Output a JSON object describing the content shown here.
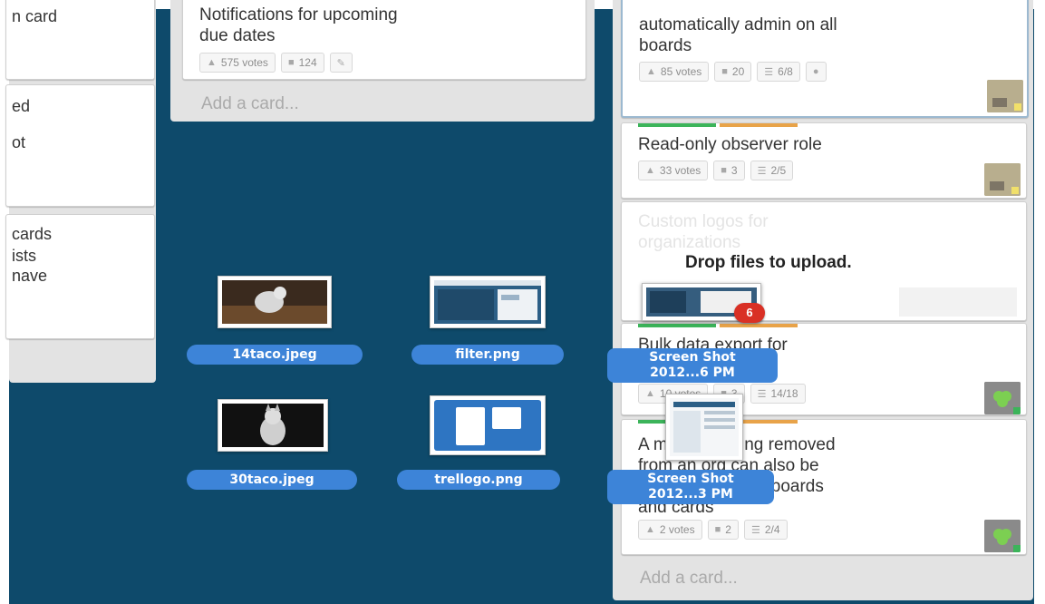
{
  "left_list": {
    "card1_text": "n card",
    "card2_lines": [
      "ed",
      "ot"
    ],
    "card3_lines": [
      "cards",
      "ists",
      "nave"
    ]
  },
  "middle_list": {
    "card": {
      "title_line1": "Notifications for upcoming",
      "title_line2": "due dates",
      "votes": "575 votes",
      "comments": "124"
    },
    "add_card": "Add a card..."
  },
  "right_list": {
    "card1": {
      "title_line1": "automatically admin on all",
      "title_line2": "boards",
      "votes": "85 votes",
      "comments": "20",
      "checklist": "6/8"
    },
    "card2": {
      "title": "Read-only observer role",
      "votes": "33 votes",
      "comments": "3",
      "checklist": "2/5"
    },
    "card3": {
      "title_line1": "Custom logos for",
      "title_line2": "organizations",
      "drop_text": "Drop files to upload."
    },
    "card4": {
      "title_line1": "Bulk data export for",
      "votes": "10 votes",
      "comments": "3",
      "checklist": "14/18"
    },
    "card5": {
      "title_line1": "A member being removed",
      "title_line2": "from an org can also be",
      "title_line3": "removed from all boards",
      "title_line4": "and cards",
      "votes": "2 votes",
      "comments": "2",
      "checklist": "2/4"
    },
    "add_card": "Add a card..."
  },
  "drag_files": [
    {
      "name": "14taco.jpeg"
    },
    {
      "name": "filter.png"
    },
    {
      "name": "30taco.jpeg"
    },
    {
      "name": "trellogo.png"
    }
  ],
  "dragged_screenshots": [
    {
      "line1": "Screen Shot",
      "line2": "2012...6 PM"
    },
    {
      "line1": "Screen Shot",
      "line2": "2012...3 PM"
    }
  ],
  "drag_count_badge": "6",
  "colors": {
    "board_bg": "#0e4a6b",
    "label_green": "#3cb45a",
    "label_orange": "#e8a349",
    "pill_blue": "#3d84d8",
    "count_red": "#d93025"
  }
}
